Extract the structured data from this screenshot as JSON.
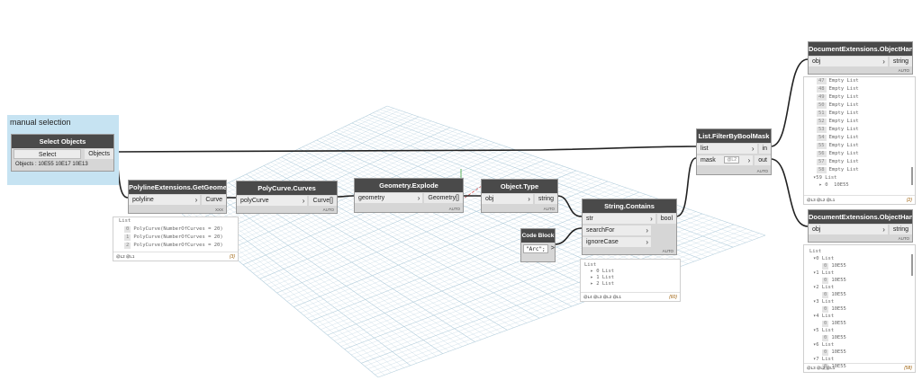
{
  "group": {
    "title": "manual selection"
  },
  "select_objects": {
    "title": "Select Objects",
    "button": "Select",
    "output": "Objects",
    "info": "Objects : 10E55 10E17 10E13"
  },
  "polyline_get_geometry": {
    "title": "PolylineExtensions.GetGeometry",
    "input": "polyline",
    "output": "Curve",
    "lacing": "XXX",
    "preview": {
      "header": "List",
      "items": [
        {
          "index": "0",
          "text": "PolyCurve(NumberOfCurves = 20)"
        },
        {
          "index": "1",
          "text": "PolyCurve(NumberOfCurves = 20)"
        },
        {
          "index": "2",
          "text": "PolyCurve(NumberOfCurves = 20)"
        }
      ],
      "levels": "@L2 @L1",
      "count": "{3}"
    }
  },
  "polycurve_curves": {
    "title": "PolyCurve.Curves",
    "input": "polyCurve",
    "output": "Curve[]",
    "lacing": "AUTO"
  },
  "geometry_explode": {
    "title": "Geometry.Explode",
    "input": "geometry",
    "output": "Geometry[]",
    "lacing": "AUTO"
  },
  "object_type": {
    "title": "Object.Type",
    "input": "obj",
    "output": "string",
    "lacing": "AUTO"
  },
  "code_block": {
    "title": "Code Block",
    "code": "\"Arc\";",
    "output": ">"
  },
  "string_contains": {
    "title": "String.Contains",
    "inputs": [
      "str",
      "searchFor",
      "ignoreCase"
    ],
    "output": "bool",
    "lacing": "AUTO",
    "preview": {
      "lines": [
        "List",
        "  ▸ 0 List",
        "  ▸ 1 List",
        "  ▸ 2 List"
      ],
      "levels": "@L4 @L3 @L2 @L1",
      "count": "{60}"
    }
  },
  "filter_by_bool_mask": {
    "title": "List.FilterByBoolMask",
    "inputs": [
      "list",
      "mask"
    ],
    "mask_default": "@L2",
    "outputs": [
      "in",
      "out"
    ],
    "lacing": "AUTO"
  },
  "object_handle_1": {
    "title": "DocumentExtensions.ObjectHandle",
    "input": "obj",
    "output": "string",
    "lacing": "AUTO",
    "preview": {
      "items": [
        {
          "index": "47",
          "text": "Empty List"
        },
        {
          "index": "48",
          "text": "Empty List"
        },
        {
          "index": "49",
          "text": "Empty List"
        },
        {
          "index": "50",
          "text": "Empty List"
        },
        {
          "index": "51",
          "text": "Empty List"
        },
        {
          "index": "52",
          "text": "Empty List"
        },
        {
          "index": "53",
          "text": "Empty List"
        },
        {
          "index": "54",
          "text": "Empty List"
        },
        {
          "index": "55",
          "text": "Empty List"
        },
        {
          "index": "56",
          "text": "Empty List"
        },
        {
          "index": "57",
          "text": "Empty List"
        },
        {
          "index": "58",
          "text": "Empty List"
        }
      ],
      "tail_lines": [
        "▾59 List",
        "  ▸ 0  10E55"
      ],
      "levels": "@L3 @L2 @L1",
      "count": "{2}"
    }
  },
  "object_handle_2": {
    "title": "DocumentExtensions.ObjectHandle",
    "input": "obj",
    "output": "string",
    "lacing": "AUTO",
    "preview": {
      "header": "List",
      "groups": [
        {
          "label": "▾0 List",
          "index": "0",
          "value": "10E55"
        },
        {
          "label": "▾1 List",
          "index": "0",
          "value": "10E55"
        },
        {
          "label": "▾2 List",
          "index": "0",
          "value": "10E55"
        },
        {
          "label": "▾3 List",
          "index": "0",
          "value": "10E55"
        },
        {
          "label": "▾4 List",
          "index": "0",
          "value": "10E55"
        },
        {
          "label": "▾5 List",
          "index": "0",
          "value": "10E55"
        },
        {
          "label": "▾6 List",
          "index": "0",
          "value": "10E55"
        },
        {
          "label": "▾7 List",
          "index": "0",
          "value": "10E55"
        }
      ],
      "levels": "@L3 @L2 @L1",
      "count": "{58}"
    }
  },
  "colors": {
    "node_header": "#4a4a4a",
    "node_body": "#d6d6d6",
    "group_bg": "#c6e3f2",
    "wire": "#222222",
    "grid": "#b5cfdd"
  }
}
